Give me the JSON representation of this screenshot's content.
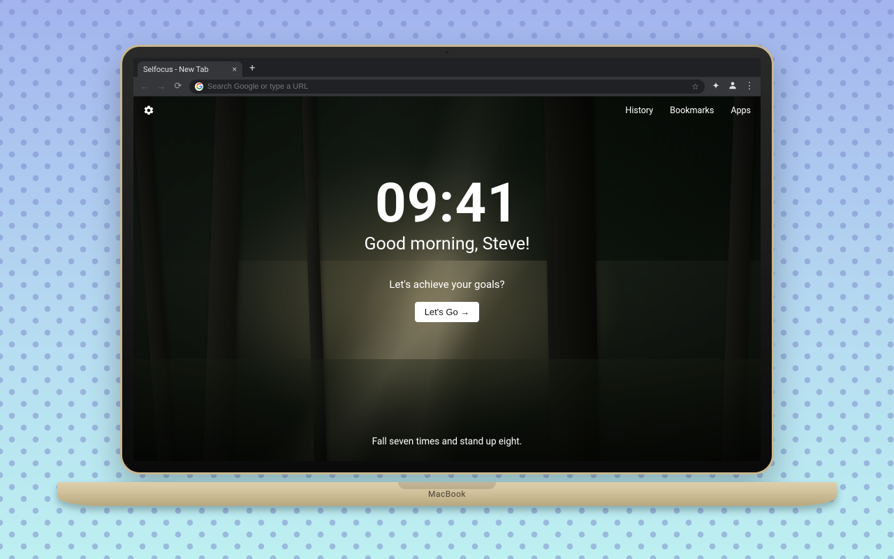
{
  "browser": {
    "tab_title": "Selfocus - New Tab",
    "omnibox_placeholder": "Search Google or type a URL"
  },
  "laptop": {
    "brand": "MacBook"
  },
  "page": {
    "nav": {
      "history": "History",
      "bookmarks": "Bookmarks",
      "apps": "Apps"
    },
    "clock": "09:41",
    "greeting": "Good morning, Steve!",
    "subheading": "Let's achieve your goals?",
    "cta_label": "Let's Go →",
    "quote": "Fall seven times and stand up eight."
  }
}
